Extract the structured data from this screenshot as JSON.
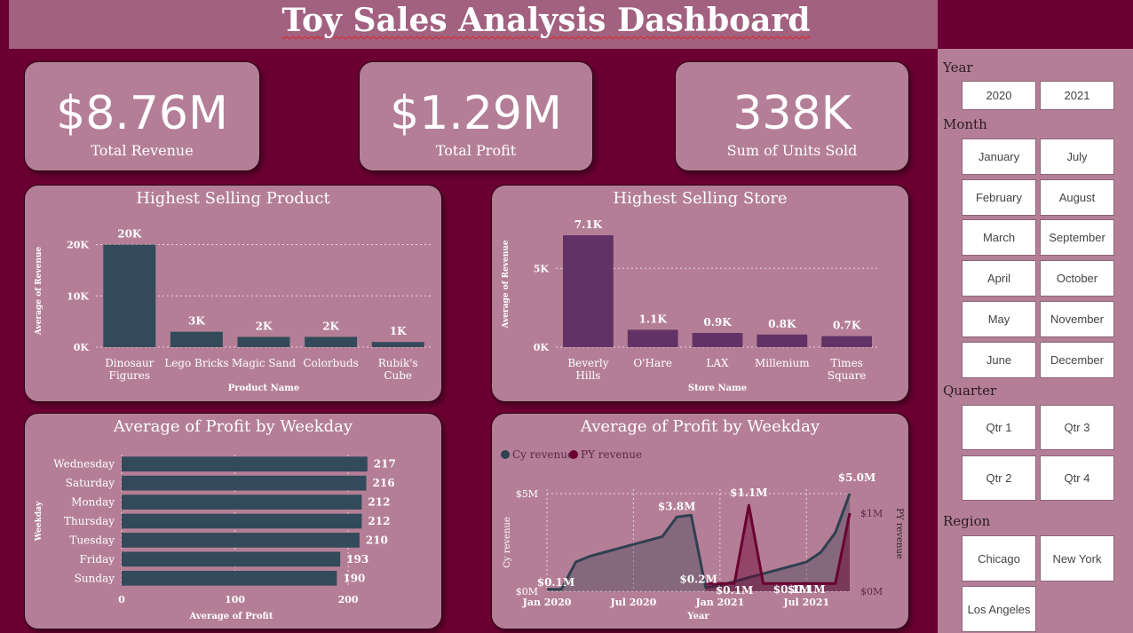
{
  "title": "Toy Sales Analysis Dashboard",
  "kpis": [
    {
      "value": "$8.76M",
      "label": "Total Revenue"
    },
    {
      "value": "$1.29M",
      "label": "Total Profit"
    },
    {
      "value": "338K",
      "label": "Sum of Units Sold"
    }
  ],
  "chart_data": [
    {
      "type": "bar",
      "title": "Highest Selling Product",
      "xlabel": "Product Name",
      "ylabel": "Average of Revenue",
      "categories": [
        "Dinosaur Figures",
        "Lego Bricks",
        "Magic Sand",
        "Colorbuds",
        "Rubik's Cube"
      ],
      "category_lines": [
        [
          "Dinosaur",
          "Figures"
        ],
        [
          "Lego Bricks"
        ],
        [
          "Magic Sand"
        ],
        [
          "Colorbuds"
        ],
        [
          "Rubik's",
          "Cube"
        ]
      ],
      "values": [
        20000,
        3000,
        2000,
        2000,
        1000
      ],
      "data_labels": [
        "20K",
        "3K",
        "2K",
        "2K",
        "1K"
      ],
      "yticks": [
        0,
        10000,
        20000
      ],
      "ytick_labels": [
        "0K",
        "10K",
        "20K"
      ],
      "ylim": [
        0,
        22000
      ],
      "color": "#324a5a",
      "grid": true
    },
    {
      "type": "bar",
      "title": "Highest Selling Store",
      "xlabel": "Store Name",
      "ylabel": "Average of Revenue",
      "categories": [
        "Beverly Hills",
        "O'Hare",
        "LAX",
        "Millenium",
        "Times Square"
      ],
      "category_lines": [
        [
          "Beverly",
          "Hills"
        ],
        [
          "O'Hare"
        ],
        [
          "LAX"
        ],
        [
          "Millenium"
        ],
        [
          "Times",
          "Square"
        ]
      ],
      "values": [
        7100,
        1100,
        900,
        800,
        700
      ],
      "data_labels": [
        "7.1K",
        "1.1K",
        "0.9K",
        "0.8K",
        "0.7K"
      ],
      "yticks": [
        0,
        5000
      ],
      "ytick_labels": [
        "0K",
        "5K"
      ],
      "ylim": [
        0,
        8000
      ],
      "color": "#623266",
      "grid": true
    },
    {
      "type": "bar",
      "orientation": "horizontal",
      "title": "Average of Profit by Weekday",
      "xlabel": "Average of Profit",
      "ylabel": "Weekday",
      "categories": [
        "Wednesday",
        "Saturday",
        "Monday",
        "Thursday",
        "Tuesday",
        "Friday",
        "Sunday"
      ],
      "values": [
        217,
        216,
        212,
        212,
        210,
        193,
        190
      ],
      "data_labels": [
        "217",
        "216",
        "212",
        "212",
        "210",
        "193",
        "190"
      ],
      "xticks": [
        0,
        100,
        200
      ],
      "xtick_labels": [
        "0",
        "100",
        "200"
      ],
      "xlim": [
        0,
        225
      ],
      "color": "#324a5a",
      "grid": true
    },
    {
      "type": "area",
      "title": "Average of Profit by Weekday",
      "xlabel": "Year",
      "ylabel": "Cy revenue",
      "y2label": "PY revenue",
      "x_ticks": [
        "Jan 2020",
        "Jul 2020",
        "Jan 2021",
        "Jul 2021"
      ],
      "x_tick_values": [
        "2020-01",
        "2020-07",
        "2021-01",
        "2021-07"
      ],
      "y_ticks": [
        "$0M",
        "$5M"
      ],
      "y2_ticks": [
        "$0M",
        "$1M"
      ],
      "legend_position": "top-left",
      "series": [
        {
          "name": "Cy revenue",
          "axis": "left",
          "color": "#2f4050",
          "x": [
            "2020-01",
            "2020-02",
            "2020-03",
            "2020-04",
            "2020-05",
            "2020-06",
            "2020-07",
            "2020-08",
            "2020-09",
            "2020-10",
            "2020-11",
            "2020-12",
            "2021-01",
            "2021-02",
            "2021-03",
            "2021-04",
            "2021-05",
            "2021-06",
            "2021-07",
            "2021-08",
            "2021-09",
            "2021-10"
          ],
          "values": [
            0.1,
            0.1,
            1.5,
            1.8,
            2.0,
            2.2,
            2.4,
            2.6,
            2.8,
            3.8,
            3.9,
            0.2,
            0.3,
            0.5,
            0.7,
            0.9,
            1.1,
            1.3,
            1.5,
            2.0,
            3.0,
            5.0
          ],
          "labels": [
            {
              "x": "2020-01",
              "text": "$0.1M"
            },
            {
              "x": "2020-10",
              "text": "$3.8M"
            },
            {
              "x": "2020-12",
              "text": "$0.2M"
            },
            {
              "x": "2021-10",
              "text": "$5.0M"
            }
          ]
        },
        {
          "name": "PY revenue",
          "axis": "right",
          "color": "#6a0031",
          "x": [
            "2020-12",
            "2021-01",
            "2021-02",
            "2021-03",
            "2021-04",
            "2021-05",
            "2021-06",
            "2021-07",
            "2021-08",
            "2021-09",
            "2021-10"
          ],
          "values": [
            0.1,
            0.1,
            0.1,
            1.1,
            0.1,
            0.1,
            0.1,
            0.1,
            0.1,
            0.1,
            1.0
          ],
          "labels": [
            {
              "x": "2021-03",
              "text": "$1.1M"
            },
            {
              "x": "2021-02",
              "text": "$0.1M"
            },
            {
              "x": "2021-06",
              "text": "$0.1M"
            },
            {
              "x": "2021-07",
              "text": "$0.1M"
            }
          ]
        }
      ]
    }
  ],
  "slicers": {
    "year": {
      "label": "Year",
      "options": [
        "2020",
        "2021"
      ]
    },
    "month": {
      "label": "Month",
      "options": [
        "January",
        "July",
        "February",
        "August",
        "March",
        "September",
        "April",
        "October",
        "May",
        "November",
        "June",
        "December"
      ]
    },
    "quarter": {
      "label": "Quarter",
      "options": [
        "Qtr 1",
        "Qtr 3",
        "Qtr 2",
        "Qtr 4"
      ]
    },
    "region": {
      "label": "Region",
      "options": [
        "Chicago",
        "New York",
        "Los Angeles"
      ]
    }
  }
}
